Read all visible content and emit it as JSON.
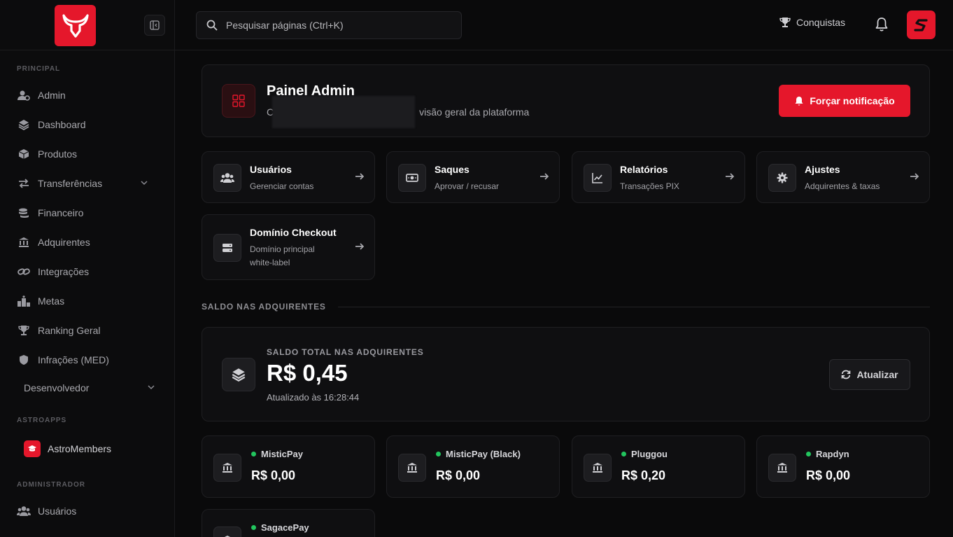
{
  "colors": {
    "accent": "#e5172b",
    "online": "#22c55e",
    "background": "#0a0a0b"
  },
  "sidebar": {
    "sections": {
      "principal": "PRINCIPAL",
      "astroapps": "ASTROAPPS",
      "administrador": "ADMINISTRADOR"
    },
    "items": [
      {
        "label": "Admin",
        "icon": "user-gear-icon"
      },
      {
        "label": "Dashboard",
        "icon": "layers-icon"
      },
      {
        "label": "Produtos",
        "icon": "box-icon"
      },
      {
        "label": "Transferências",
        "icon": "arrows-icon"
      },
      {
        "label": "Financeiro",
        "icon": "coins-icon"
      },
      {
        "label": "Adquirentes",
        "icon": "bank-icon"
      },
      {
        "label": "Integrações",
        "icon": "link-icon"
      },
      {
        "label": "Metas",
        "icon": "podium-icon"
      },
      {
        "label": "Ranking Geral",
        "icon": "trophy-icon"
      },
      {
        "label": "Infrações (MED)",
        "icon": "shield-icon"
      }
    ],
    "developer": "Desenvolvedor",
    "astromembers": "AstroMembers",
    "admin_users": "Usuários"
  },
  "topbar": {
    "search_placeholder": "Pesquisar páginas (Ctrl+K)",
    "achievements": "Conquistas"
  },
  "header": {
    "title": "Painel Admin",
    "subtitle_start": "C",
    "subtitle_end": "visão geral da plataforma",
    "notify_button": "Forçar notificação"
  },
  "quick_actions": [
    {
      "title": "Usuários",
      "subtitle": "Gerenciar contas"
    },
    {
      "title": "Saques",
      "subtitle": "Aprovar / recusar"
    },
    {
      "title": "Relatórios",
      "subtitle": "Transações PIX"
    },
    {
      "title": "Ajustes",
      "subtitle": "Adquirentes & taxas"
    },
    {
      "title": "Domínio Checkout",
      "subtitle": "Domínio principal white-label"
    }
  ],
  "balance": {
    "section_title": "SALDO NAS ADQUIRENTES",
    "total_label": "SALDO TOTAL NAS ADQUIRENTES",
    "total_value": "R$ 0,45",
    "updated": "Atualizado às 16:28:44",
    "refresh_button": "Atualizar",
    "acquirers": [
      {
        "name": "MisticPay",
        "value": "R$ 0,00"
      },
      {
        "name": "MisticPay (Black)",
        "value": "R$ 0,00"
      },
      {
        "name": "Pluggou",
        "value": "R$ 0,20"
      },
      {
        "name": "Rapdyn",
        "value": "R$ 0,00"
      },
      {
        "name": "SagacePay",
        "value": ""
      }
    ]
  }
}
